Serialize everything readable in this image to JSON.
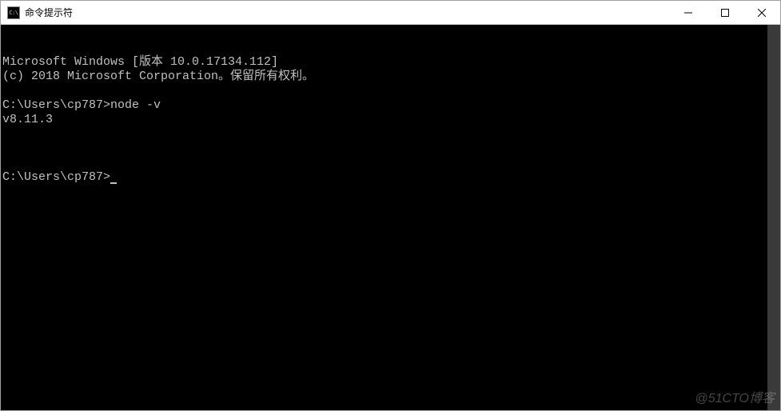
{
  "window": {
    "title": "命令提示符",
    "icon_label": "C:\\"
  },
  "terminal": {
    "lines": [
      "Microsoft Windows [版本 10.0.17134.112]",
      "(c) 2018 Microsoft Corporation。保留所有权利。",
      "",
      "C:\\Users\\cp787>node -v",
      "v8.11.3",
      ""
    ],
    "prompt": "C:\\Users\\cp787>"
  },
  "watermark": "@51CTO博客"
}
